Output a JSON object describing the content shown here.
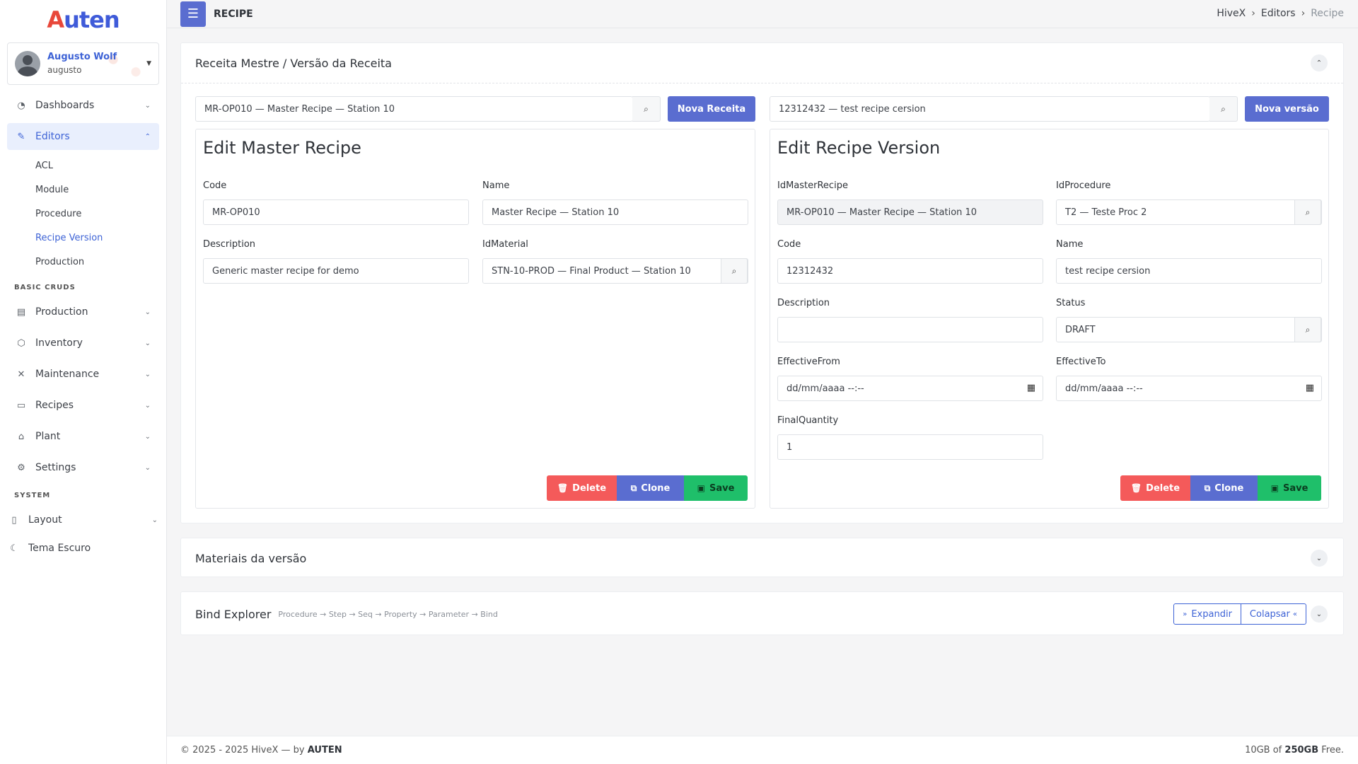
{
  "brand": {
    "logo_a": "A",
    "logo_rest": "uten"
  },
  "user": {
    "name": "Augusto Wolf",
    "login": "augusto"
  },
  "sidebar": {
    "dashboards": "Dashboards",
    "editors": "Editors",
    "editors_items": [
      "ACL",
      "Module",
      "Procedure",
      "Recipe Version",
      "Production"
    ],
    "section_basic": "BASIC CRUDS",
    "basic_items": [
      "Production",
      "Inventory",
      "Maintenance",
      "Recipes",
      "Plant",
      "Settings"
    ],
    "section_system": "SYSTEM",
    "layout": "Layout",
    "theme": "Tema Escuro"
  },
  "topbar": {
    "title": "RECIPE",
    "breadcrumb": [
      "HiveX",
      "Editors",
      "Recipe"
    ]
  },
  "recipe_panel": {
    "title": "Receita Mestre / Versão da Receita",
    "master_search": "MR-OP010 — Master Recipe — Station 10",
    "new_master_label": "Nova Receita",
    "version_search": "12312432 — test recipe cersion",
    "new_version_label": "Nova versão"
  },
  "master_form": {
    "title": "Edit Master Recipe",
    "code_label": "Code",
    "code": "MR-OP010",
    "name_label": "Name",
    "name": "Master Recipe — Station 10",
    "description_label": "Description",
    "description": "Generic master recipe for demo",
    "material_label": "IdMaterial",
    "material": "STN-10-PROD — Final Product — Station 10"
  },
  "version_form": {
    "title": "Edit Recipe Version",
    "master_label": "IdMasterRecipe",
    "master": "MR-OP010 — Master Recipe — Station 10",
    "procedure_label": "IdProcedure",
    "procedure": "T2 — Teste Proc 2",
    "code_label": "Code",
    "code": "12312432",
    "name_label": "Name",
    "name": "test recipe cersion",
    "description_label": "Description",
    "description": "",
    "status_label": "Status",
    "status": "DRAFT",
    "from_label": "EffectiveFrom",
    "from": "dd/mm/aaaa --:--",
    "to_label": "EffectiveTo",
    "to": "dd/mm/aaaa --:--",
    "qty_label": "FinalQuantity",
    "qty": "1"
  },
  "actions": {
    "delete": "Delete",
    "clone": "Clone",
    "save": "Save"
  },
  "materials_panel": {
    "title": "Materiais da versão"
  },
  "bind_panel": {
    "title": "Bind Explorer",
    "subtitle": "Procedure → Step → Seq → Property → Parameter → Bind",
    "expand": "Expandir",
    "collapse": "Colapsar"
  },
  "footer": {
    "copyright": "© 2025 - 2025 HiveX — by",
    "brand": "AUTEN",
    "storage_used": "10GB of",
    "storage_total": "250GB",
    "storage_suffix": "Free."
  },
  "colors": {
    "primary": "#5a6dd0",
    "danger": "#f45a5a",
    "success": "#1fbf6a",
    "accent": "#3e63d6"
  }
}
